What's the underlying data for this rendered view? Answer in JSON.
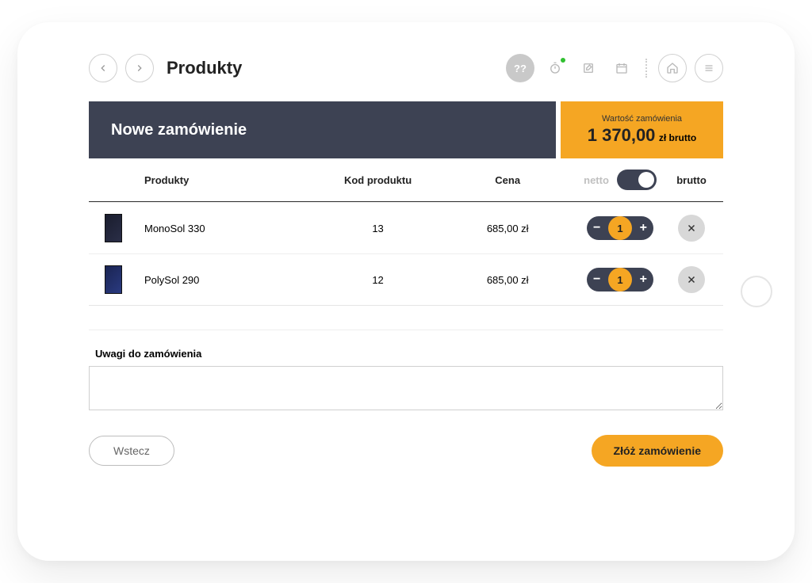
{
  "header": {
    "page_title": "Produkty",
    "help_label": "??"
  },
  "order": {
    "title": "Nowe zamówienie",
    "value_label": "Wartość zamówienia",
    "value_amount": "1 370,00",
    "value_suffix": "zł brutto"
  },
  "table": {
    "col_products": "Produkty",
    "col_code": "Kod produktu",
    "col_price": "Cena",
    "toggle_netto": "netto",
    "toggle_brutto": "brutto",
    "rows": [
      {
        "name": "MonoSol 330",
        "code": "13",
        "price": "685,00 zł",
        "qty": "1"
      },
      {
        "name": "PolySol 290",
        "code": "12",
        "price": "685,00 zł",
        "qty": "1"
      }
    ]
  },
  "notes": {
    "label": "Uwagi do zamówienia"
  },
  "footer": {
    "back": "Wstecz",
    "submit": "Złóż zamówienie"
  }
}
